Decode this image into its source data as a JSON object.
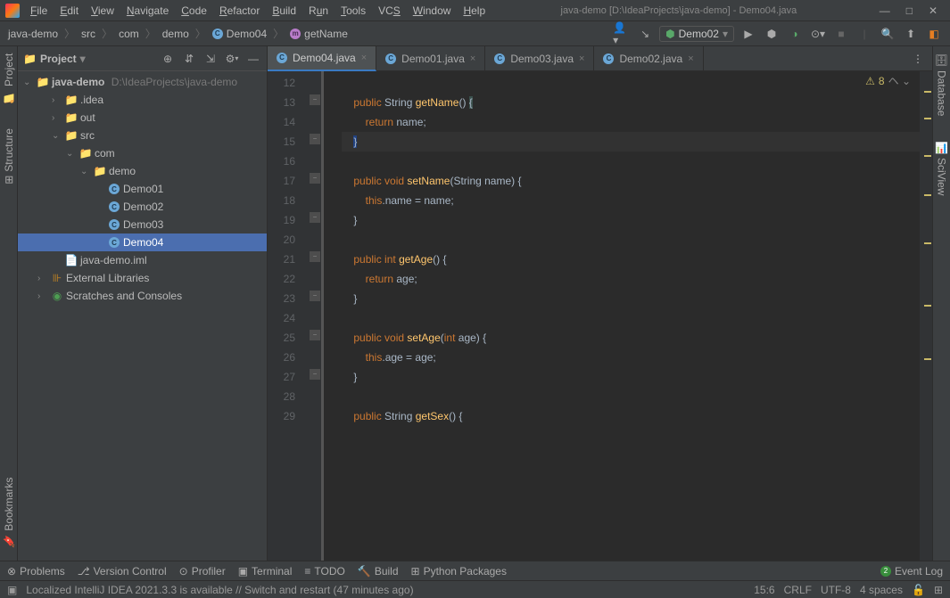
{
  "title": "java-demo [D:\\IdeaProjects\\java-demo] - Demo04.java",
  "menu": [
    {
      "label": "File",
      "u": 0
    },
    {
      "label": "Edit",
      "u": 0
    },
    {
      "label": "View",
      "u": 0
    },
    {
      "label": "Navigate",
      "u": 0
    },
    {
      "label": "Code",
      "u": 0
    },
    {
      "label": "Refactor",
      "u": 0
    },
    {
      "label": "Build",
      "u": 0
    },
    {
      "label": "Run",
      "u": 1
    },
    {
      "label": "Tools",
      "u": 0
    },
    {
      "label": "VCS",
      "u": 2
    },
    {
      "label": "Window",
      "u": 0
    },
    {
      "label": "Help",
      "u": 0
    }
  ],
  "breadcrumb": [
    "java-demo",
    "src",
    "com",
    "demo",
    "Demo04",
    "getName"
  ],
  "run_config": "Demo02",
  "left_tabs": [
    "Project",
    "Structure",
    "Bookmarks"
  ],
  "right_tabs": [
    "Database",
    "SciView"
  ],
  "project_panel": {
    "title": "Project",
    "root": "java-demo",
    "root_path": "D:\\IdeaProjects\\java-demo",
    "items": [
      {
        "label": ".idea",
        "type": "folder",
        "depth": 1,
        "arrow": ">"
      },
      {
        "label": "out",
        "type": "folder-orange",
        "depth": 1,
        "arrow": ">"
      },
      {
        "label": "src",
        "type": "folder-blue",
        "depth": 1,
        "arrow": "v"
      },
      {
        "label": "com",
        "type": "folder",
        "depth": 2,
        "arrow": "v"
      },
      {
        "label": "demo",
        "type": "folder",
        "depth": 3,
        "arrow": "v"
      },
      {
        "label": "Demo01",
        "type": "class",
        "depth": 4
      },
      {
        "label": "Demo02",
        "type": "class",
        "depth": 4
      },
      {
        "label": "Demo03",
        "type": "class",
        "depth": 4
      },
      {
        "label": "Demo04",
        "type": "class",
        "depth": 4,
        "selected": true
      },
      {
        "label": "java-demo.iml",
        "type": "file",
        "depth": 1
      },
      {
        "label": "External Libraries",
        "type": "lib",
        "depth": 0,
        "arrow": ">"
      },
      {
        "label": "Scratches and Consoles",
        "type": "scratch",
        "depth": 0,
        "arrow": ">"
      }
    ]
  },
  "tabs": [
    {
      "label": "Demo04.java",
      "active": true
    },
    {
      "label": "Demo01.java"
    },
    {
      "label": "Demo03.java"
    },
    {
      "label": "Demo02.java"
    }
  ],
  "warning_count": "8",
  "code_start_line": 12,
  "code_lines": [
    "",
    "    public String getName() {",
    "        return name;",
    "    }",
    "",
    "    public void setName(String name) {",
    "        this.name = name;",
    "    }",
    "",
    "    public int getAge() {",
    "        return age;",
    "    }",
    "",
    "    public void setAge(int age) {",
    "        this.age = age;",
    "    }",
    "",
    "    public String getSex() {"
  ],
  "caret_line": 15,
  "bottom_tools": [
    "Problems",
    "Version Control",
    "Profiler",
    "Terminal",
    "TODO",
    "Build",
    "Python Packages"
  ],
  "event_log": "Event Log",
  "status_message": "Localized IntelliJ IDEA 2021.3.3 is available // Switch and restart (47 minutes ago)",
  "status_right": {
    "pos": "15:6",
    "le": "CRLF",
    "enc": "UTF-8",
    "indent": "4 spaces"
  }
}
